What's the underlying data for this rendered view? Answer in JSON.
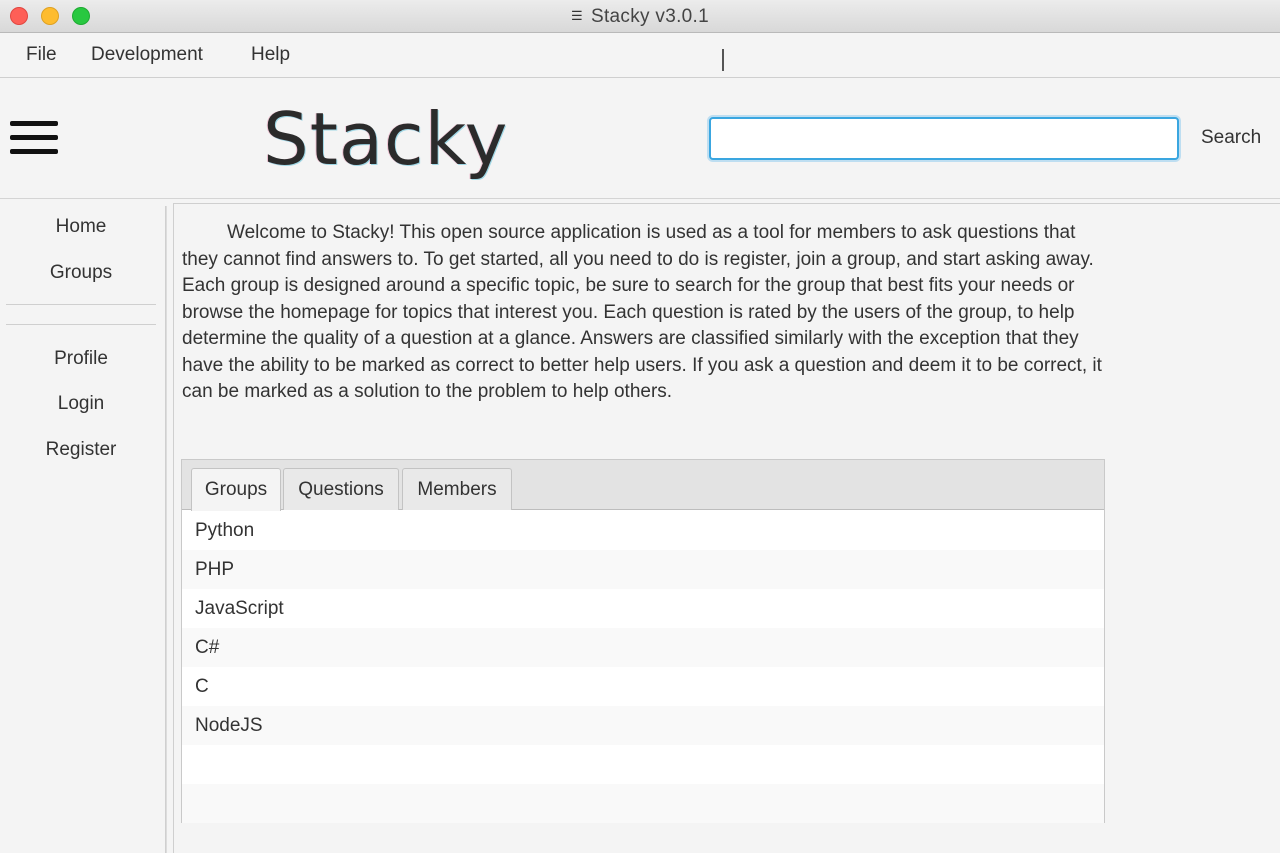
{
  "window": {
    "title": "Stacky v3.0.1",
    "app_icon": "stack-icon"
  },
  "menu": {
    "items": [
      "File",
      "Development",
      "Help"
    ]
  },
  "header": {
    "brand": "Stacky",
    "search_value": "",
    "search_button": "Search"
  },
  "sidebar": {
    "primary": [
      "Home",
      "Groups"
    ],
    "secondary": [
      "Profile",
      "Login",
      "Register"
    ]
  },
  "intro": "Welcome to Stacky! This open source application is used as a tool for members to ask questions that they cannot find answers to. To get started, all you need to do is register, join a group, and start asking away. Each group is designed around a specific topic, be sure to search for the group that best fits your needs or browse the homepage for topics that interest you. Each question is rated by the users of the group, to help determine the quality of a question at a glance. Answers are classified similarly with the exception that they have the ability to be marked as correct to better help users. If you ask a question and deem it to be correct, it can be marked as a solution to the problem to help others.",
  "tabs": {
    "items": [
      "Groups",
      "Questions",
      "Members"
    ],
    "active": "Groups"
  },
  "groups_list": [
    "Python",
    "PHP",
    "JavaScript",
    "C#",
    "C",
    "NodeJS",
    "",
    ""
  ]
}
